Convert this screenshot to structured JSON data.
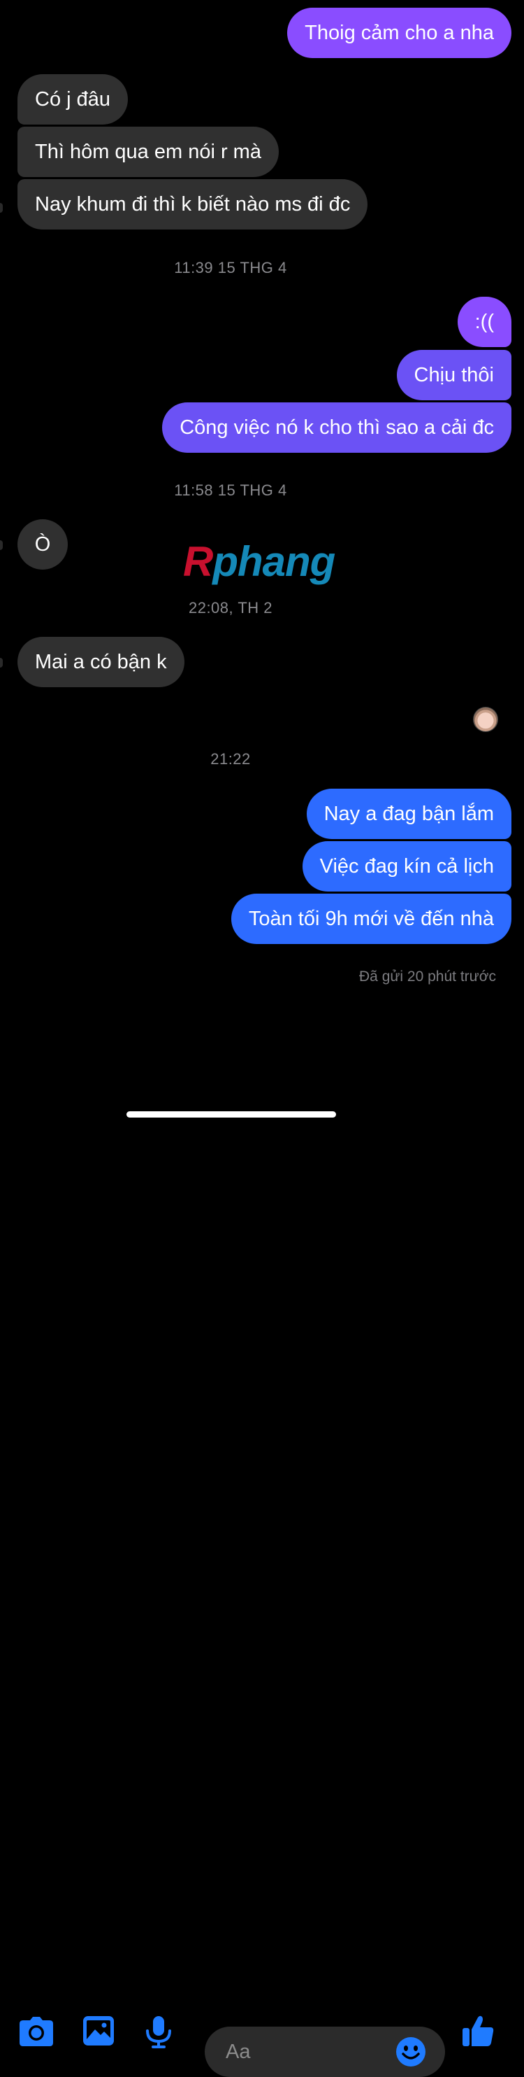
{
  "messages": [
    {
      "text": "Thoig cảm cho a nha",
      "dir": "out"
    },
    {
      "text": "Có j đâu",
      "dir": "in"
    },
    {
      "text": "Thì hôm qua em nói r mà",
      "dir": "in"
    },
    {
      "text": "Nay khum đi thì k biết nào ms đi đc",
      "dir": "in"
    },
    {
      "text": ":((",
      "dir": "out"
    },
    {
      "text": "Chịu thôi",
      "dir": "out"
    },
    {
      "text": "Công việc nó k cho thì sao a cải đc",
      "dir": "out"
    },
    {
      "text": "Ò",
      "dir": "in"
    },
    {
      "text": "Mai a có bận k",
      "dir": "in"
    },
    {
      "text": "Nay a đag bận lắm",
      "dir": "out"
    },
    {
      "text": "Việc đag kín cả lịch",
      "dir": "out"
    },
    {
      "text": "Toàn tối 9h mới về đến nhà",
      "dir": "out"
    }
  ],
  "timestamps": [
    "11:39 15 THG 4",
    "11:58 15 THG 4",
    "22:08, TH 2",
    "21:22"
  ],
  "status": {
    "seen": "Đã gửi 20 phút trước"
  },
  "watermark": {
    "part1": "R",
    "part2": "phang"
  },
  "composer": {
    "placeholder": "Aa",
    "icons": [
      "camera-icon",
      "gallery-icon",
      "microphone-icon",
      "emoji-icon",
      "thumbs-up-icon"
    ]
  },
  "colors": {
    "background": "#000000",
    "incoming_bubble": "#303030",
    "outgoing_purple": "#8a4dff",
    "outgoing_violet": "#6b52f5",
    "outgoing_blue": "#2d6bff",
    "accent_icon": "#1f7bff"
  }
}
